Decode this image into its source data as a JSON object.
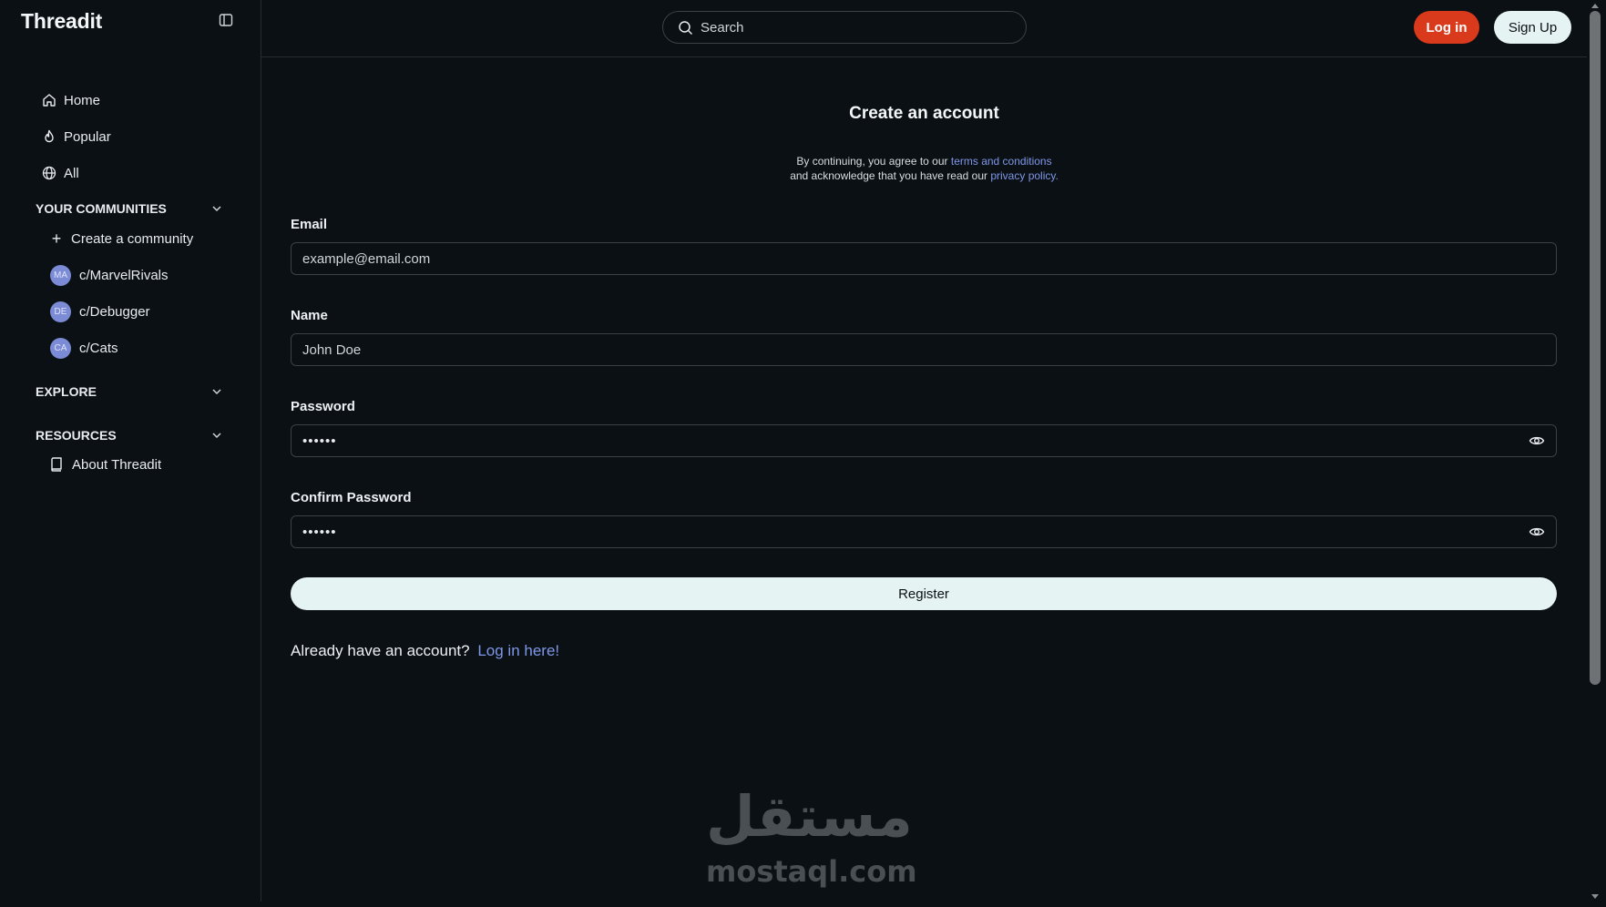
{
  "app": {
    "name": "Threadit"
  },
  "sidebar": {
    "nav": [
      {
        "label": "Home",
        "icon": "home-icon"
      },
      {
        "label": "Popular",
        "icon": "flame-icon"
      },
      {
        "label": "All",
        "icon": "globe-icon"
      }
    ],
    "communities": {
      "title": "YOUR COMMUNITIES",
      "create_label": "Create a community",
      "items": [
        {
          "initials": "MA",
          "label": "c/MarvelRivals"
        },
        {
          "initials": "DE",
          "label": "c/Debugger"
        },
        {
          "initials": "CA",
          "label": "c/Cats"
        }
      ]
    },
    "explore": {
      "title": "EXPLORE"
    },
    "resources": {
      "title": "RESOURCES",
      "items": [
        {
          "label": "About Threadit",
          "icon": "book-icon"
        }
      ]
    }
  },
  "header": {
    "search_placeholder": "Search",
    "login_label": "Log in",
    "signup_label": "Sign Up"
  },
  "form": {
    "title": "Create an account",
    "disclaimer_prefix": "By continuing, you agree to our ",
    "terms_link": "terms and conditions",
    "disclaimer_middle": "and acknowledge that you have read our ",
    "privacy_link": "privacy policy.",
    "email": {
      "label": "Email",
      "placeholder": "example@email.com"
    },
    "name": {
      "label": "Name",
      "placeholder": "John Doe"
    },
    "password": {
      "label": "Password",
      "value": "••••••"
    },
    "confirm_password": {
      "label": "Confirm Password",
      "value": "••••••"
    },
    "register_label": "Register",
    "already_text": "Already have an account?",
    "login_link": "Log in here!"
  },
  "watermark": {
    "arabic": "مستقل",
    "latin": "mostaql.com"
  },
  "colors": {
    "background": "#0b1014",
    "accent_red": "#d93a1b",
    "link_blue": "#7f97e8",
    "light_button": "#e6f3f3",
    "avatar": "#7b8bd6"
  }
}
